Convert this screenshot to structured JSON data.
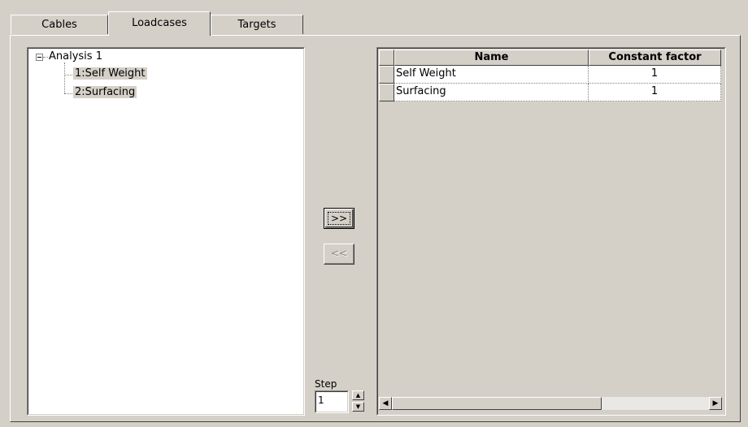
{
  "tabs": [
    {
      "label": "Cables",
      "active": false
    },
    {
      "label": "Loadcases",
      "active": true
    },
    {
      "label": "Targets",
      "active": false
    }
  ],
  "tree": {
    "root": "Analysis 1",
    "children": [
      "1:Self Weight",
      "2:Surfacing"
    ]
  },
  "transfer": {
    "add_label": ">>",
    "remove_label": "<<"
  },
  "step": {
    "label": "Step",
    "value": "1",
    "up_icon": "arrow-up-icon",
    "down_icon": "arrow-down-icon"
  },
  "grid": {
    "columns": [
      "Name",
      "Constant factor"
    ],
    "rows": [
      {
        "name": "Self Weight",
        "factor": "1"
      },
      {
        "name": "Surfacing",
        "factor": "1"
      }
    ]
  },
  "scrollbar": {
    "left_icon": "arrow-left-icon",
    "right_icon": "arrow-right-icon"
  }
}
